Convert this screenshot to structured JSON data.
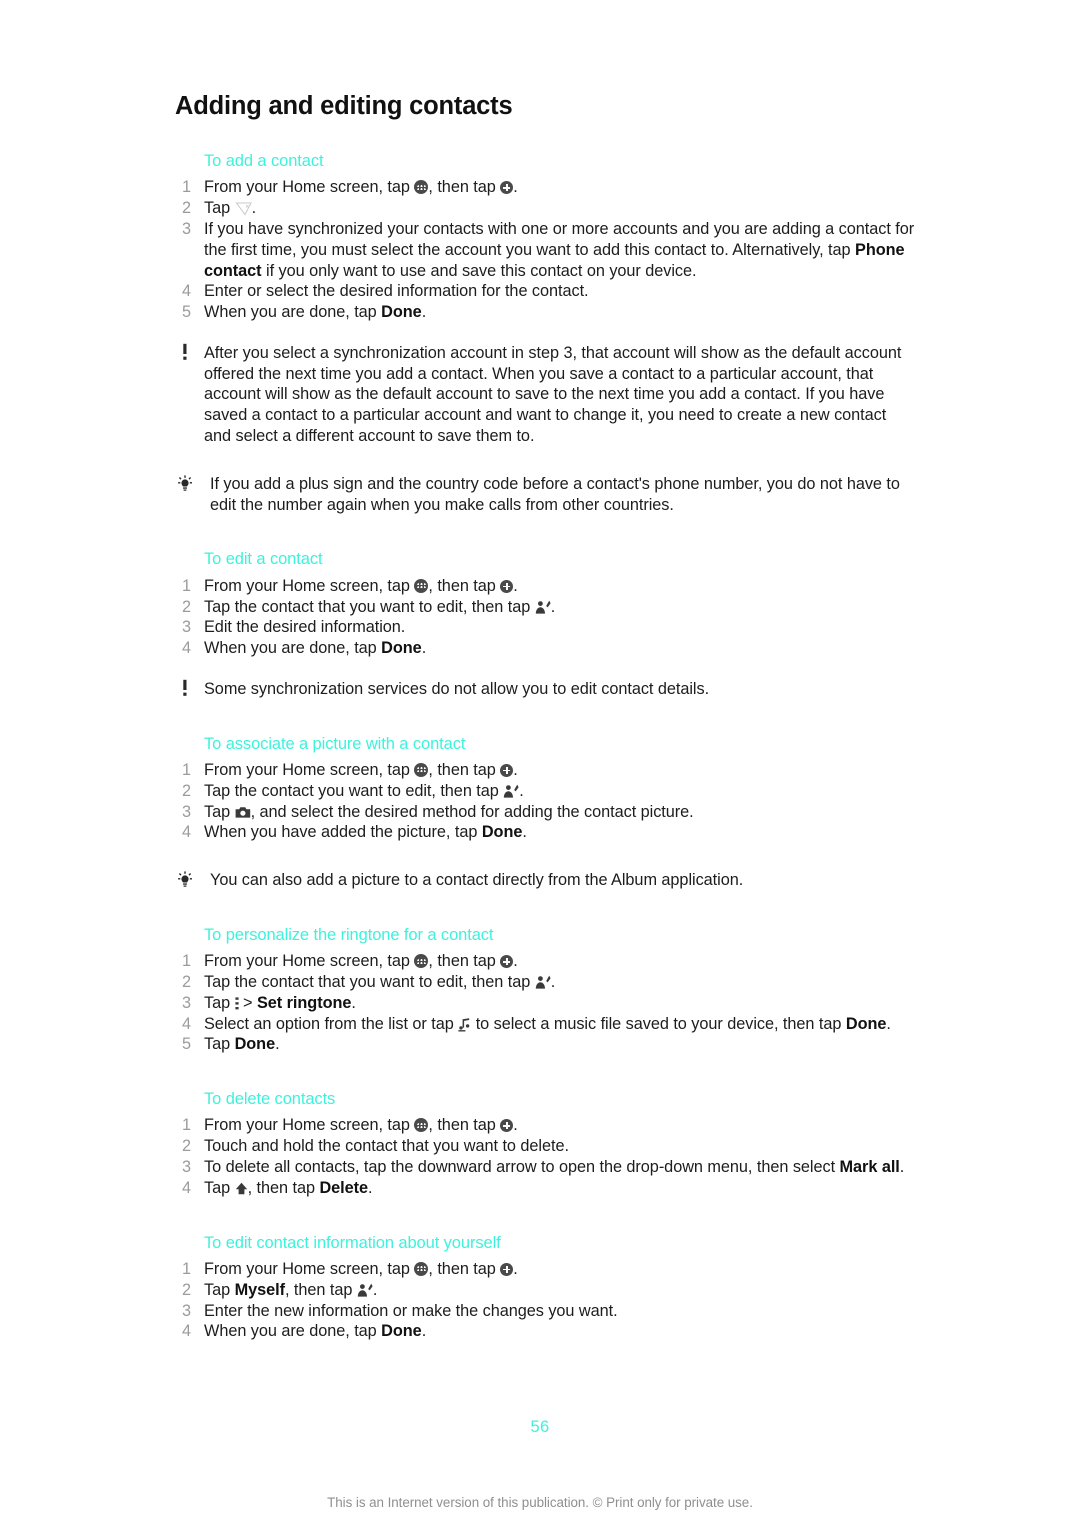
{
  "document": {
    "title": "Adding and editing contacts",
    "page_number": "56",
    "footer_note": "This is an Internet version of this publication. © Print only for private use.",
    "heading_color": "#3DF2DC",
    "page_number_color": "#3DF2DC",
    "body_text_color": "#1d1d1d",
    "step_number_color": "#9b9b9b"
  },
  "sections": [
    {
      "heading": "To add a contact",
      "steps": [
        {
          "num": "1",
          "parts": [
            {
              "t": "text",
              "v": "From your Home screen, tap "
            },
            {
              "t": "icon",
              "v": "app-drawer-icon"
            },
            {
              "t": "text",
              "v": ", then tap "
            },
            {
              "t": "icon",
              "v": "add-circle-icon"
            },
            {
              "t": "text",
              "v": "."
            }
          ]
        },
        {
          "num": "2",
          "parts": [
            {
              "t": "text",
              "v": "Tap "
            },
            {
              "t": "icon",
              "v": "new-contact-icon"
            },
            {
              "t": "text",
              "v": "."
            }
          ]
        },
        {
          "num": "3",
          "parts": [
            {
              "t": "text",
              "v": "If you have synchronized your contacts with one or more accounts and you are adding a contact for the first time, you must select the account you want to add this contact to. Alternatively, tap "
            },
            {
              "t": "bold",
              "v": "Phone contact"
            },
            {
              "t": "text",
              "v": " if you only want to use and save this contact on your device."
            }
          ]
        },
        {
          "num": "4",
          "parts": [
            {
              "t": "text",
              "v": "Enter or select the desired information for the contact."
            }
          ]
        },
        {
          "num": "5",
          "parts": [
            {
              "t": "text",
              "v": "When you are done, tap "
            },
            {
              "t": "bold",
              "v": "Done"
            },
            {
              "t": "text",
              "v": "."
            }
          ]
        }
      ],
      "notes": [
        {
          "icon": "exclamation-icon",
          "kind": "warning",
          "parts": [
            {
              "t": "text",
              "v": "After you select a synchronization account in step 3, that account will show as the default account offered the next time you add a contact. When you save a contact to a particular account, that account will show as the default account to save to the next time you add a contact. If you have saved a contact to a particular account and want to change it, you need to create a new contact and select a different account to save them to."
            }
          ]
        },
        {
          "icon": "lightbulb-icon",
          "kind": "tip",
          "parts": [
            {
              "t": "text",
              "v": "If you add a plus sign and the country code before a contact's phone number, you do not have to edit the number again when you make calls from other countries."
            }
          ]
        }
      ]
    },
    {
      "heading": "To edit a contact",
      "steps": [
        {
          "num": "1",
          "parts": [
            {
              "t": "text",
              "v": "From your Home screen, tap "
            },
            {
              "t": "icon",
              "v": "app-drawer-icon"
            },
            {
              "t": "text",
              "v": ", then tap "
            },
            {
              "t": "icon",
              "v": "add-circle-icon"
            },
            {
              "t": "text",
              "v": "."
            }
          ]
        },
        {
          "num": "2",
          "parts": [
            {
              "t": "text",
              "v": "Tap the contact that you want to edit, then tap "
            },
            {
              "t": "icon",
              "v": "edit-contact-icon"
            },
            {
              "t": "text",
              "v": "."
            }
          ]
        },
        {
          "num": "3",
          "parts": [
            {
              "t": "text",
              "v": "Edit the desired information."
            }
          ]
        },
        {
          "num": "4",
          "parts": [
            {
              "t": "text",
              "v": "When you are done, tap "
            },
            {
              "t": "bold",
              "v": "Done"
            },
            {
              "t": "text",
              "v": "."
            }
          ]
        }
      ],
      "notes": [
        {
          "icon": "exclamation-icon",
          "kind": "warning",
          "parts": [
            {
              "t": "text",
              "v": "Some synchronization services do not allow you to edit contact details."
            }
          ]
        }
      ]
    },
    {
      "heading": "To associate a picture with a contact",
      "steps": [
        {
          "num": "1",
          "parts": [
            {
              "t": "text",
              "v": "From your Home screen, tap "
            },
            {
              "t": "icon",
              "v": "app-drawer-icon"
            },
            {
              "t": "text",
              "v": ", then tap "
            },
            {
              "t": "icon",
              "v": "add-circle-icon"
            },
            {
              "t": "text",
              "v": "."
            }
          ]
        },
        {
          "num": "2",
          "parts": [
            {
              "t": "text",
              "v": "Tap the contact you want to edit, then tap "
            },
            {
              "t": "icon",
              "v": "edit-contact-icon"
            },
            {
              "t": "text",
              "v": "."
            }
          ]
        },
        {
          "num": "3",
          "parts": [
            {
              "t": "text",
              "v": "Tap "
            },
            {
              "t": "icon",
              "v": "camera-icon"
            },
            {
              "t": "text",
              "v": ", and select the desired method for adding the contact picture."
            }
          ]
        },
        {
          "num": "4",
          "parts": [
            {
              "t": "text",
              "v": "When you have added the picture, tap "
            },
            {
              "t": "bold",
              "v": "Done"
            },
            {
              "t": "text",
              "v": "."
            }
          ]
        }
      ],
      "notes": [
        {
          "icon": "lightbulb-icon",
          "kind": "tip",
          "parts": [
            {
              "t": "text",
              "v": "You can also add a picture to a contact directly from the Album application."
            }
          ]
        }
      ]
    },
    {
      "heading": "To personalize the ringtone for a contact",
      "steps": [
        {
          "num": "1",
          "parts": [
            {
              "t": "text",
              "v": "From your Home screen, tap "
            },
            {
              "t": "icon",
              "v": "app-drawer-icon"
            },
            {
              "t": "text",
              "v": ", then tap "
            },
            {
              "t": "icon",
              "v": "add-circle-icon"
            },
            {
              "t": "text",
              "v": "."
            }
          ]
        },
        {
          "num": "2",
          "parts": [
            {
              "t": "text",
              "v": "Tap the contact that you want to edit, then tap "
            },
            {
              "t": "icon",
              "v": "edit-contact-icon"
            },
            {
              "t": "text",
              "v": "."
            }
          ]
        },
        {
          "num": "3",
          "parts": [
            {
              "t": "text",
              "v": "Tap "
            },
            {
              "t": "icon",
              "v": "overflow-menu-icon"
            },
            {
              "t": "text",
              "v": " > "
            },
            {
              "t": "bold",
              "v": "Set ringtone"
            },
            {
              "t": "text",
              "v": "."
            }
          ]
        },
        {
          "num": "4",
          "parts": [
            {
              "t": "text",
              "v": "Select an option from the list or tap "
            },
            {
              "t": "icon",
              "v": "music-note-icon"
            },
            {
              "t": "text",
              "v": " to select a music file saved to your device, then tap "
            },
            {
              "t": "bold",
              "v": "Done"
            },
            {
              "t": "text",
              "v": "."
            }
          ]
        },
        {
          "num": "5",
          "parts": [
            {
              "t": "text",
              "v": "Tap "
            },
            {
              "t": "bold",
              "v": "Done"
            },
            {
              "t": "text",
              "v": "."
            }
          ]
        }
      ],
      "notes": []
    },
    {
      "heading": "To delete contacts",
      "steps": [
        {
          "num": "1",
          "parts": [
            {
              "t": "text",
              "v": "From your Home screen, tap "
            },
            {
              "t": "icon",
              "v": "app-drawer-icon"
            },
            {
              "t": "text",
              "v": ", then tap "
            },
            {
              "t": "icon",
              "v": "add-circle-icon"
            },
            {
              "t": "text",
              "v": "."
            }
          ]
        },
        {
          "num": "2",
          "parts": [
            {
              "t": "text",
              "v": "Touch and hold the contact that you want to delete."
            }
          ]
        },
        {
          "num": "3",
          "parts": [
            {
              "t": "text",
              "v": "To delete all contacts, tap the downward arrow to open the drop-down menu, then select "
            },
            {
              "t": "bold",
              "v": "Mark all"
            },
            {
              "t": "text",
              "v": "."
            }
          ]
        },
        {
          "num": "4",
          "parts": [
            {
              "t": "text",
              "v": "Tap "
            },
            {
              "t": "icon",
              "v": "up-arrow-icon"
            },
            {
              "t": "text",
              "v": ", then tap "
            },
            {
              "t": "bold",
              "v": "Delete"
            },
            {
              "t": "text",
              "v": "."
            }
          ]
        }
      ],
      "notes": []
    },
    {
      "heading": "To edit contact information about yourself",
      "steps": [
        {
          "num": "1",
          "parts": [
            {
              "t": "text",
              "v": "From your Home screen, tap "
            },
            {
              "t": "icon",
              "v": "app-drawer-icon"
            },
            {
              "t": "text",
              "v": ", then tap "
            },
            {
              "t": "icon",
              "v": "add-circle-icon"
            },
            {
              "t": "text",
              "v": "."
            }
          ]
        },
        {
          "num": "2",
          "parts": [
            {
              "t": "text",
              "v": "Tap "
            },
            {
              "t": "bold",
              "v": "Myself"
            },
            {
              "t": "text",
              "v": ", then tap "
            },
            {
              "t": "icon",
              "v": "edit-contact-icon"
            },
            {
              "t": "text",
              "v": "."
            }
          ]
        },
        {
          "num": "3",
          "parts": [
            {
              "t": "text",
              "v": "Enter the new information or make the changes you want."
            }
          ]
        },
        {
          "num": "4",
          "parts": [
            {
              "t": "text",
              "v": "When you are done, tap "
            },
            {
              "t": "bold",
              "v": "Done"
            },
            {
              "t": "text",
              "v": "."
            }
          ]
        }
      ],
      "notes": []
    }
  ]
}
